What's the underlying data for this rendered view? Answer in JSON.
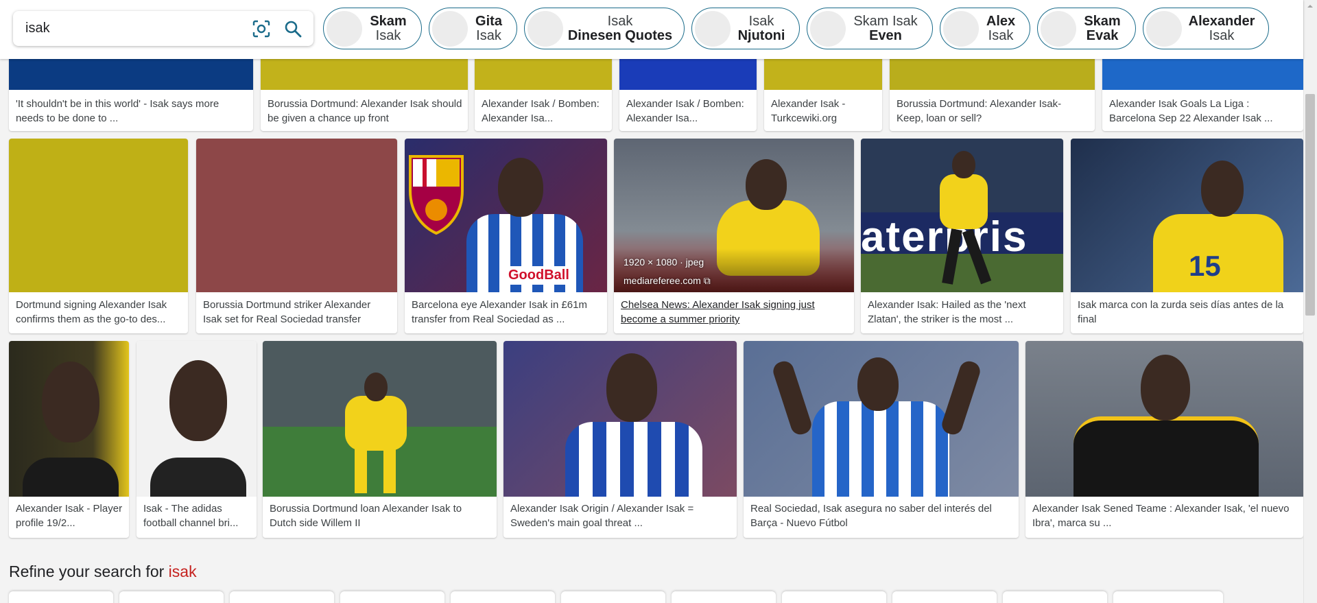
{
  "search": {
    "query": "isak"
  },
  "chips": [
    {
      "line1": "Skam",
      "line2": "Isak",
      "bold": 1
    },
    {
      "line1": "Gita",
      "line2": "Isak",
      "bold": 1
    },
    {
      "line1": "Isak",
      "line2": "Dinesen Quotes",
      "bold": 2
    },
    {
      "line1": "Isak",
      "line2": "Njutoni",
      "bold": 2
    },
    {
      "line1": "Skam Isak",
      "line2": "Even",
      "bold": 2
    },
    {
      "line1": "Alex",
      "line2": "Isak",
      "bold": 1
    },
    {
      "line1": "Skam",
      "line2": "Evak",
      "bold": 0
    },
    {
      "line1": "Alexander",
      "line2": "Isak",
      "bold": 1
    }
  ],
  "row1": [
    {
      "caption": "'It shouldn't be in this world' - Isak says more needs to be done to ...",
      "color": "#0b3b82"
    },
    {
      "caption": "Borussia Dortmund: Alexander Isak should be given a chance up front",
      "color": "#c2b21b"
    },
    {
      "caption": "Alexander Isak / Bomben: Alexander Isa...",
      "color": "#c2b21b"
    },
    {
      "caption": "Alexander Isak / Bomben: Alexander Isa...",
      "color": "#1a3cb8"
    },
    {
      "caption": "Alexander Isak - Turkcewiki.org",
      "color": "#c2b21b"
    },
    {
      "caption": "Borussia Dortmund: Alexander Isak- Keep, loan or sell?",
      "color": "#b9ad1c"
    },
    {
      "caption": "Alexander Isak Goals La Liga : Barcelona Sep 22 Alexander Isak ...",
      "color": "#1e68c8"
    }
  ],
  "row2": [
    {
      "caption": "Dortmund signing Alexander Isak confirms them as the go-to des...",
      "color": "#bfb016"
    },
    {
      "caption": "Borussia Dortmund striker Alexander Isak set for Real Sociedad transfer",
      "color": "#8d4748"
    },
    {
      "caption": "Barcelona eye Alexander Isak in £61m transfer from Real Sociedad as ...",
      "color": "#2d2f6e"
    },
    {
      "caption": "Chelsea News: Alexander Isak signing just become a summer priority",
      "color": "#5f6a78",
      "meta": "1920 × 1080 · jpeg",
      "source": "mediareferee.com"
    },
    {
      "caption": "Alexander Isak: Hailed as the 'next Zlatan', the striker is the most ...",
      "color": "#26324a"
    },
    {
      "caption": "Isak marca con la zurda seis días antes de la final",
      "color": "#3e5272"
    }
  ],
  "row3": [
    {
      "caption": "Alexander Isak - Player profile 19/2...",
      "color": "#2d2a1c"
    },
    {
      "caption": "Isak - The adidas football channel bri...",
      "color": "#f2f2f2"
    },
    {
      "caption": "Borussia Dortmund loan Alexander Isak to Dutch side Willem II",
      "color": "#5e6a60"
    },
    {
      "caption": "Alexander Isak Origin / Alexander Isak = Sweden's main goal threat ...",
      "color": "#44508c"
    },
    {
      "caption": "Real Sociedad, Isak asegura no saber del interés del Barça - Nuevo Fútbol",
      "color": "#5a6f95"
    },
    {
      "caption": "Alexander Isak Sened Teame : Alexander Isak, 'el nuevo Ibra', marca su ...",
      "color": "#6c7480"
    }
  ],
  "refine": {
    "prefix": "Refine your search for ",
    "term": "isak"
  }
}
